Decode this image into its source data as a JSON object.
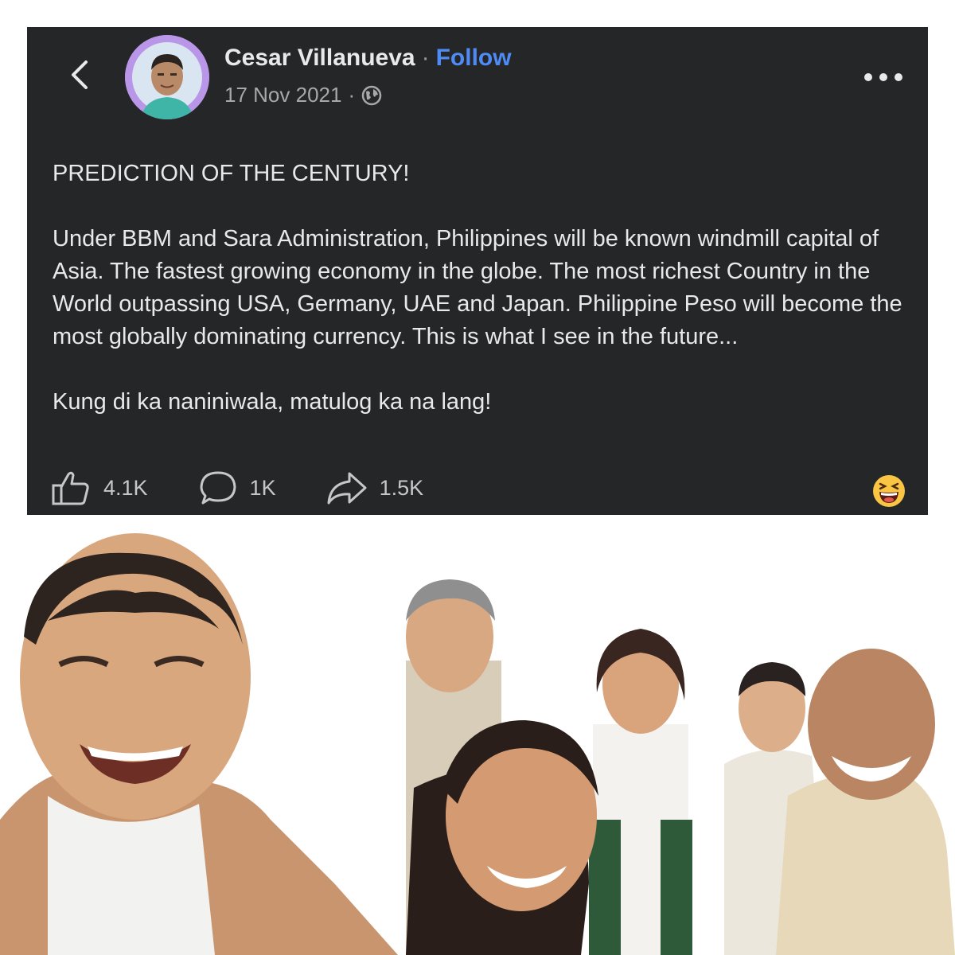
{
  "post": {
    "author": "Cesar Villanueva",
    "separator": "·",
    "follow_label": "Follow",
    "date": "17 Nov 2021",
    "date_separator": "·",
    "audience_icon": "globe-icon",
    "paragraphs": [
      "PREDICTION OF THE CENTURY!",
      "Under BBM and Sara Administration, Philippines will be known windmill capital of Asia. The fastest growing economy in the globe. The most richest Country in the World outpassing USA, Germany, UAE and Japan. Philippine Peso will become the most globally dominating currency. This is what I see in the future...",
      "Kung di ka naniniwala, matulog ka na lang!"
    ],
    "actions": {
      "likes": "4.1K",
      "comments": "1K",
      "shares": "1.5K"
    },
    "reaction_icon": "grinning-squint-emoji-icon"
  },
  "colors": {
    "post_background": "#252628",
    "text": "#e9e9ea",
    "muted": "#a8a8ab",
    "follow": "#4e8bf5",
    "avatar_ring": "#b996e8"
  }
}
